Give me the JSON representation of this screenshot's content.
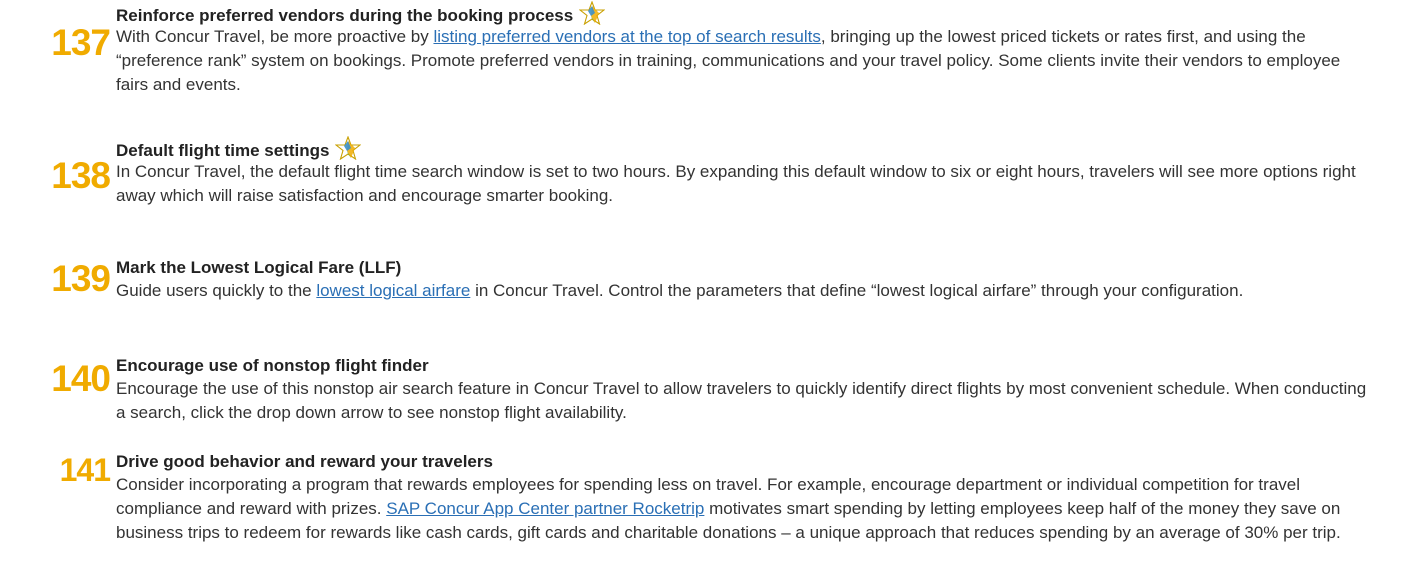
{
  "colors": {
    "number": "#f0ab00",
    "link": "#2a6fb5",
    "star_outline": "#c9a000",
    "star_fill_a": "#3b8fc8",
    "star_fill_b": "#f0ab00"
  },
  "tips": [
    {
      "number": "137",
      "title": "Reinforce preferred vendors during the booking process",
      "starred": true,
      "body": {
        "pre": "With Concur Travel, be more proactive by ",
        "link": "listing preferred vendors at the top of search results",
        "post": ", bringing up the lowest priced tickets or rates first, and using the “preference rank” system on bookings. Promote preferred vendors in training, communications and your travel policy. Some clients invite their vendors to employee fairs and events."
      }
    },
    {
      "number": "138",
      "title": "Default flight time settings",
      "starred": true,
      "body": {
        "pre": "In Concur Travel, the default flight time search window is set to two hours. By expanding this default window to six or eight hours, travelers will see more options right away which will raise satisfaction and encourage smarter booking.",
        "link": "",
        "post": ""
      }
    },
    {
      "number": "139",
      "title": "Mark the Lowest Logical Fare (LLF)",
      "starred": false,
      "body": {
        "pre": "Guide users quickly to the ",
        "link": "lowest logical airfare",
        "post": " in Concur Travel. Control the parameters that define “lowest logical airfare” through your configuration."
      }
    },
    {
      "number": "140",
      "title": "Encourage use of nonstop flight finder",
      "starred": false,
      "body": {
        "pre": "Encourage the use of this nonstop air search feature in Concur Travel to allow travelers to quickly identify direct flights by most convenient schedule. When conducting a search, click the drop down arrow to see nonstop flight availability.",
        "link": "",
        "post": ""
      }
    },
    {
      "number": "141",
      "title": "Drive good behavior and reward your travelers",
      "starred": false,
      "body": {
        "pre": "Consider incorporating a program that rewards employees for spending less on travel. For example, encourage department or individual competition for travel compliance and reward with prizes. ",
        "link": "SAP Concur App Center partner Rocketrip",
        "post": " motivates smart spending by letting employees keep half of the money they save on business trips to redeem for rewards like cash cards, gift cards and charitable donations – a unique approach that reduces spending by an average of 30% per trip."
      }
    }
  ]
}
